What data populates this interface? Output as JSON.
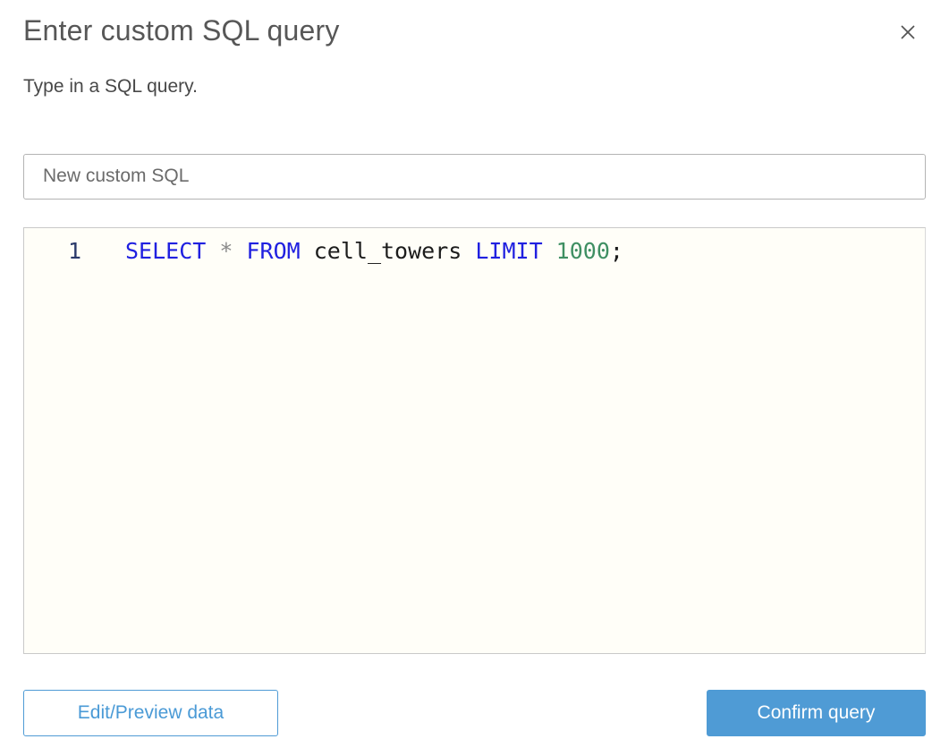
{
  "dialog": {
    "title": "Enter custom SQL query",
    "subtitle": "Type in a SQL query."
  },
  "name_input": {
    "value": "New custom SQL"
  },
  "editor": {
    "line_number": "1",
    "full_query": "SELECT * FROM cell_towers LIMIT 1000;",
    "line1": {
      "tokens": [
        {
          "text": "SELECT ",
          "type": "keyword"
        },
        {
          "text": "* ",
          "type": "operator"
        },
        {
          "text": "FROM ",
          "type": "keyword"
        },
        {
          "text": "cell_towers ",
          "type": "identifier"
        },
        {
          "text": "LIMIT ",
          "type": "keyword"
        },
        {
          "text": "1000",
          "type": "number"
        },
        {
          "text": ";",
          "type": "punctuation"
        }
      ]
    }
  },
  "footer": {
    "edit_preview_label": "Edit/Preview data",
    "confirm_label": "Confirm query"
  },
  "icons": {
    "close": "close-icon"
  },
  "colors": {
    "accent_blue": "#4f9bd5",
    "keyword_blue": "#2020e0",
    "number_green": "#3f8f63",
    "identifier_dark": "#1c1c1c",
    "operator_gray": "#8a8a8a",
    "gutter_navy": "#2b3a6b",
    "editor_background": "#fffef8",
    "title_gray": "#575757"
  }
}
